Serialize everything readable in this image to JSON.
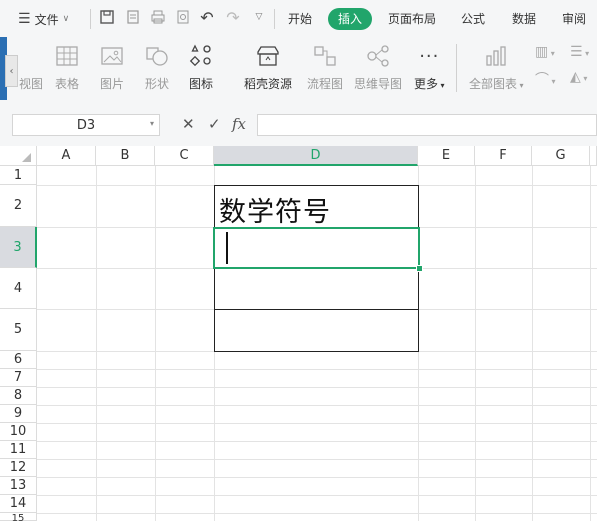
{
  "menu": {
    "file_label": "文件"
  },
  "tabs": [
    {
      "label": "开始"
    },
    {
      "label": "插入"
    },
    {
      "label": "页面布局"
    },
    {
      "label": "公式"
    },
    {
      "label": "数据"
    },
    {
      "label": "审阅"
    }
  ],
  "active_tab": "插入",
  "ribbon": [
    {
      "label": "视图",
      "icon": "pivot-view-icon"
    },
    {
      "label": "表格",
      "icon": "table-icon"
    },
    {
      "label": "图片",
      "icon": "picture-icon"
    },
    {
      "label": "形状",
      "icon": "shapes-icon"
    },
    {
      "label": "图标",
      "icon": "icons-icon"
    },
    {
      "label": "稻壳资源",
      "icon": "docer-resources-icon"
    },
    {
      "label": "流程图",
      "icon": "flowchart-icon"
    },
    {
      "label": "思维导图",
      "icon": "mindmap-icon"
    },
    {
      "label": "更多",
      "icon": "more-icon"
    },
    {
      "label": "全部图表",
      "icon": "all-charts-icon"
    }
  ],
  "formula_bar": {
    "name_box": "D3",
    "fx_label": "fx",
    "formula": ""
  },
  "columns": [
    "A",
    "B",
    "C",
    "D",
    "E",
    "F",
    "G"
  ],
  "selected_column": "D",
  "rows": [
    "1",
    "2",
    "3",
    "4",
    "5",
    "6",
    "7",
    "8",
    "9",
    "10",
    "11",
    "12",
    "13",
    "14",
    "15"
  ],
  "selected_row": "3",
  "cells": {
    "D2": "数学符号",
    "D3": ""
  },
  "colors": {
    "accent": "#21a56b",
    "ribbon_bg": "#f5f6f7"
  }
}
